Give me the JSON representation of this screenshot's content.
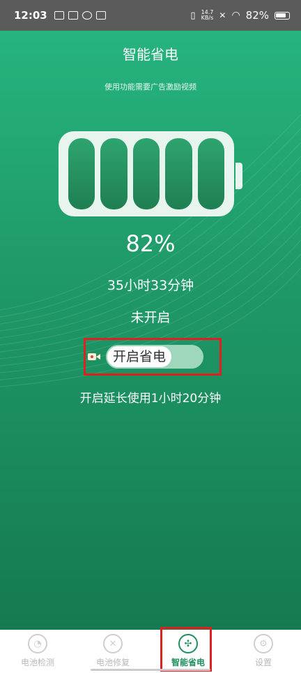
{
  "status_bar": {
    "time": "12:03",
    "net_speed_value": "14.7",
    "net_speed_unit": "KB/s",
    "battery_percent": "82%",
    "icons": [
      "mail-icon",
      "calendar-icon",
      "link-icon",
      "bluetooth-icon",
      "vibrate-icon",
      "sim-off-icon",
      "wifi-icon",
      "battery-icon"
    ]
  },
  "page": {
    "title": "智能省电",
    "subtitle": "使用功能需要广告激励视频"
  },
  "battery": {
    "percent": "82%",
    "remaining": "35小时33分钟",
    "status": "未开启",
    "cells_filled": 5,
    "colors": {
      "shell": "#e7f5ee",
      "cell": "#1f7f52"
    }
  },
  "toggle": {
    "label": "开启省电",
    "icon": "video-ad-icon"
  },
  "extend_text": "开启延长使用1小时20分钟",
  "bottom_nav": {
    "items": [
      {
        "label": "电池检测",
        "icon": "battery-detect-icon",
        "active": false
      },
      {
        "label": "电池修复",
        "icon": "repair-tools-icon",
        "active": false
      },
      {
        "label": "智能省电",
        "icon": "smart-save-icon",
        "active": true
      },
      {
        "label": "设置",
        "icon": "settings-gear-icon",
        "active": false
      }
    ]
  },
  "theme": {
    "primary": "#1f8f5f",
    "highlight": "#e02020"
  }
}
